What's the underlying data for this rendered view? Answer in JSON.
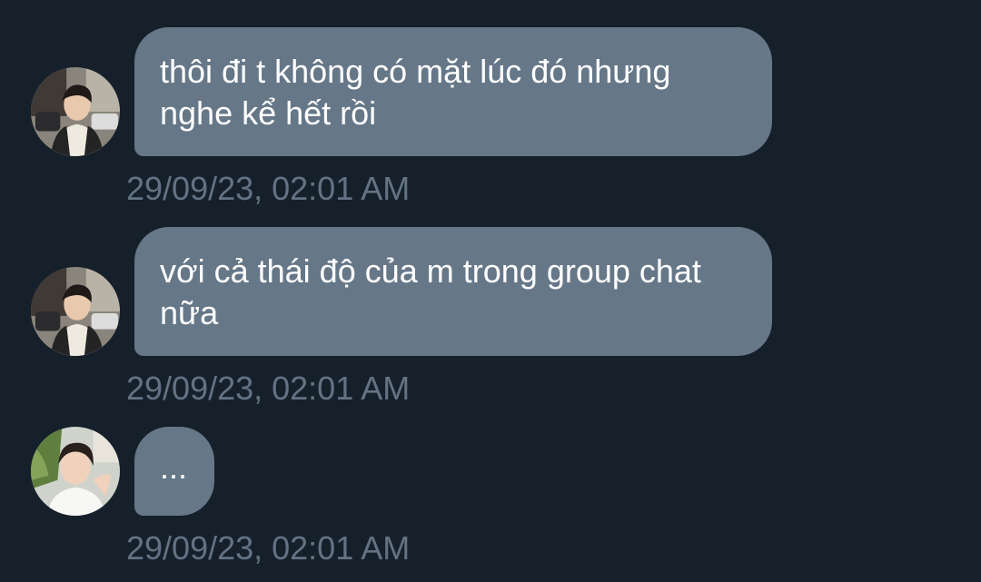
{
  "messages": [
    {
      "avatar": "avatar-photo-user-a",
      "text": "thôi đi t không có mặt lúc đó nhưng\nnghe kể hết rồi",
      "time": "29/09/23, 02:01 AM"
    },
    {
      "avatar": "avatar-photo-user-a",
      "text": "với cả thái độ của m trong group chat\nnữa",
      "time": "29/09/23, 02:01 AM"
    },
    {
      "avatar": "avatar-photo-user-b",
      "text": "...",
      "time": "29/09/23, 02:01 AM"
    }
  ],
  "colors": {
    "background": "#16202b",
    "bubble": "#667788",
    "bubble_text": "#ffffff",
    "timestamp": "#637383"
  }
}
